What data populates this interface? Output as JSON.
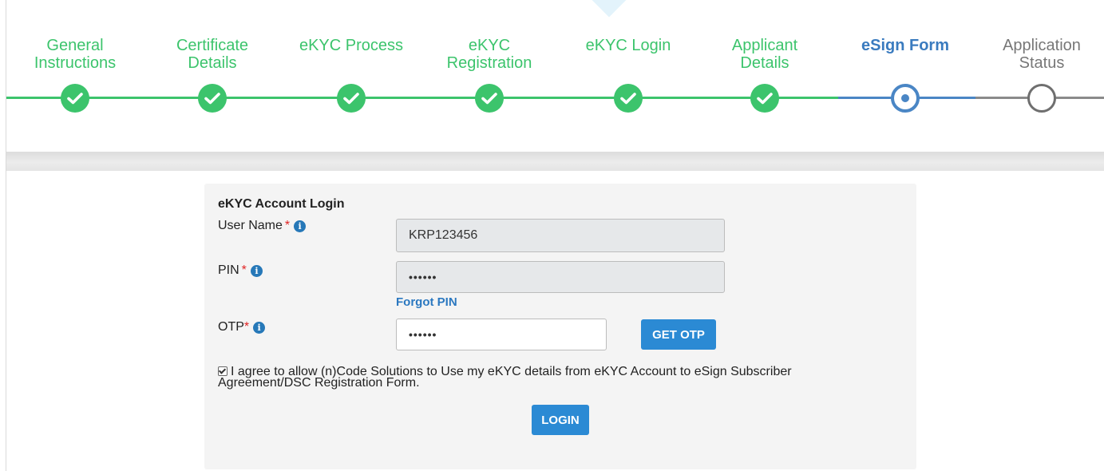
{
  "stepper": {
    "steps": [
      {
        "label_line1": "General",
        "label_line2": "Instructions",
        "state": "done",
        "icon": "check-icon"
      },
      {
        "label_line1": "Certificate",
        "label_line2": "Details",
        "state": "done",
        "icon": "check-icon"
      },
      {
        "label_line1": "eKYC Process",
        "label_line2": "",
        "state": "done",
        "icon": "check-icon"
      },
      {
        "label_line1": "eKYC",
        "label_line2": "Registration",
        "state": "done",
        "icon": "check-icon"
      },
      {
        "label_line1": "eKYC Login",
        "label_line2": "",
        "state": "done",
        "icon": "check-icon"
      },
      {
        "label_line1": "Applicant",
        "label_line2": "Details",
        "state": "done",
        "icon": "check-icon"
      },
      {
        "label_line1": "eSign Form",
        "label_line2": "",
        "state": "active",
        "icon": "current-step-icon"
      },
      {
        "label_line1": "Application",
        "label_line2": "Status",
        "state": "todo",
        "icon": "pending-step-icon"
      }
    ],
    "colors": {
      "done": "#3cc46c",
      "active": "#4a86c5",
      "todo": "#8a8a8a"
    }
  },
  "login_form": {
    "title": "eKYC Account Login",
    "username": {
      "label": "User Name",
      "required_mark": "*",
      "value": "KRP123456"
    },
    "pin": {
      "label": "PIN",
      "required_mark": "*",
      "value": "••••••"
    },
    "forgot_pin": "Forgot PIN",
    "otp": {
      "label": "OTP",
      "required_mark": "*",
      "value": "••••••"
    },
    "get_otp_button": "GET OTP",
    "agreement": {
      "checked": true,
      "text": "I agree to allow (n)Code Solutions to Use my eKYC details from eKYC Account to eSign Subscriber Agreement/DSC Registration Form."
    },
    "login_button": "LOGIN"
  },
  "colors": {
    "accent": "#2b8ad4",
    "required": "#e02424",
    "link": "#2b78c0"
  }
}
